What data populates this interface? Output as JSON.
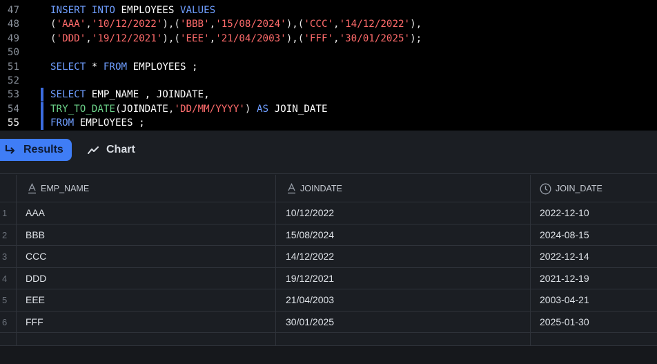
{
  "editor": {
    "active_line": "55",
    "lines": [
      {
        "n": "47",
        "tokens": [
          [
            "kw",
            "INSERT "
          ],
          [
            "kw",
            "INTO "
          ],
          [
            "id",
            "EMPLOYEES "
          ],
          [
            "kw",
            "VALUES"
          ]
        ]
      },
      {
        "n": "48",
        "tokens": [
          [
            "pn",
            "("
          ],
          [
            "str",
            "'AAA'"
          ],
          [
            "pn",
            ","
          ],
          [
            "str",
            "'10/12/2022'"
          ],
          [
            "pn",
            "),("
          ],
          [
            "str",
            "'BBB'"
          ],
          [
            "pn",
            ","
          ],
          [
            "str",
            "'15/08/2024'"
          ],
          [
            "pn",
            "),("
          ],
          [
            "str",
            "'CCC'"
          ],
          [
            "pn",
            ","
          ],
          [
            "str",
            "'14/12/2022'"
          ],
          [
            "pn",
            "),"
          ]
        ]
      },
      {
        "n": "49",
        "tokens": [
          [
            "pn",
            "("
          ],
          [
            "str",
            "'DDD'"
          ],
          [
            "pn",
            ","
          ],
          [
            "str",
            "'19/12/2021'"
          ],
          [
            "pn",
            "),("
          ],
          [
            "str",
            "'EEE'"
          ],
          [
            "pn",
            ","
          ],
          [
            "str",
            "'21/04/2003'"
          ],
          [
            "pn",
            "),("
          ],
          [
            "str",
            "'FFF'"
          ],
          [
            "pn",
            ","
          ],
          [
            "str",
            "'30/01/2025'"
          ],
          [
            "pn",
            ");"
          ]
        ]
      },
      {
        "n": "50",
        "tokens": []
      },
      {
        "n": "51",
        "tokens": [
          [
            "kw",
            "SELECT "
          ],
          [
            "id",
            "* "
          ],
          [
            "kw",
            "FROM "
          ],
          [
            "id",
            "EMPLOYEES ;"
          ]
        ]
      },
      {
        "n": "52",
        "tokens": []
      },
      {
        "n": "53",
        "sel": true,
        "tokens": [
          [
            "kw",
            "SELECT "
          ],
          [
            "id",
            "EMP_NAME , JOINDATE,"
          ]
        ]
      },
      {
        "n": "54",
        "sel": true,
        "tokens": [
          [
            "fn",
            "TRY_TO_DATE"
          ],
          [
            "pn",
            "("
          ],
          [
            "id",
            "JOINDATE"
          ],
          [
            "pn",
            ","
          ],
          [
            "str",
            "'DD/MM/YYYY'"
          ],
          [
            "pn",
            ") "
          ],
          [
            "kw",
            "AS "
          ],
          [
            "id",
            "JOIN_DATE"
          ]
        ]
      },
      {
        "n": "55",
        "sel": true,
        "tokens": [
          [
            "kw",
            "FROM "
          ],
          [
            "id",
            "EMPLOYEES ;"
          ]
        ]
      }
    ]
  },
  "toolbar": {
    "results_label": "Results",
    "chart_label": "Chart",
    "results_icon": "return-arrow-icon",
    "chart_icon": "trend-line-icon"
  },
  "table": {
    "columns": [
      {
        "name": "EMP_NAME",
        "type_icon": "text-type-icon"
      },
      {
        "name": "JOINDATE",
        "type_icon": "text-type-icon"
      },
      {
        "name": "JOIN_DATE",
        "type_icon": "clock-type-icon"
      }
    ],
    "rows": [
      {
        "n": "1",
        "cells": [
          "AAA",
          "10/12/2022",
          "2022-12-10"
        ]
      },
      {
        "n": "2",
        "cells": [
          "BBB",
          "15/08/2024",
          "2024-08-15"
        ]
      },
      {
        "n": "3",
        "cells": [
          "CCC",
          "14/12/2022",
          "2022-12-14"
        ]
      },
      {
        "n": "4",
        "cells": [
          "DDD",
          "19/12/2021",
          "2021-12-19"
        ]
      },
      {
        "n": "5",
        "cells": [
          "EEE",
          "21/04/2003",
          "2003-04-21"
        ]
      },
      {
        "n": "6",
        "cells": [
          "FFF",
          "30/01/2025",
          "2025-01-30"
        ]
      }
    ]
  },
  "colors": {
    "keyword": "#6f9eff",
    "string": "#ff6b6b",
    "function": "#6cd38a",
    "accent": "#3f7df6"
  }
}
